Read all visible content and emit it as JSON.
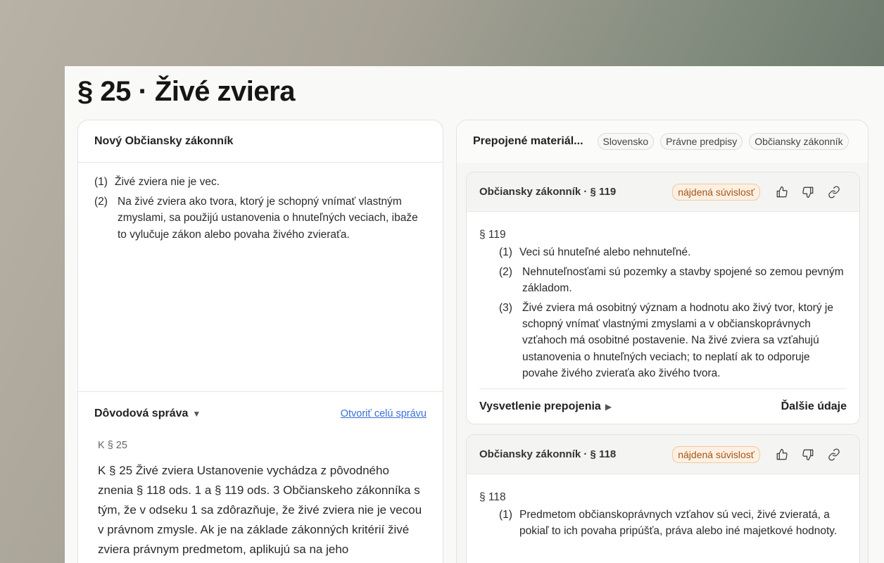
{
  "page_title": "§ 25 · Živé zviera",
  "left": {
    "header": "Nový Občiansky zákonník",
    "paragraphs": [
      {
        "num": "(1)",
        "text": "Živé zviera nie je vec."
      },
      {
        "num": "(2)",
        "text": "Na živé zviera ako tvora, ktorý je schopný vnímať vlastným zmyslami, sa použijú ustanovenia o hnuteľných veciach, ibaže to vylučuje zákon alebo povaha živého zvieraťa."
      }
    ],
    "report": {
      "title": "Dôvodová správa",
      "link": "Otvoriť celú správu",
      "ref": "K § 25",
      "text": "K § 25 Živé zviera Ustanovenie vychádza z pôvodného znenia § 118 ods. 1 a § 119 ods. 3 Občianskeho zákonníka s tým, že v odseku 1 sa zdôrazňuje, že živé zviera nie je vecou v právnom zmysle. Ak je na základe zákonných kritérií živé zviera právnym predmetom, aplikujú sa na jeho"
    }
  },
  "right": {
    "header": "Prepojené materiál...",
    "tags": [
      "Slovensko",
      "Právne predpisy",
      "Občiansky zákonník"
    ],
    "cards": [
      {
        "title": "Občiansky zákonník · § 119",
        "badge": "nájdená súvislosť",
        "section": "§ 119",
        "paragraphs": [
          {
            "num": "(1)",
            "text": "Veci sú hnuteľné alebo nehnuteľné."
          },
          {
            "num": "(2)",
            "text": "Nehnuteľnosťami sú pozemky a stavby spojené so zemou pevným základom."
          },
          {
            "num": "(3)",
            "text": "Živé zviera má osobitný význam a hodnotu ako živý tvor, ktorý je schopný vnímať vlastnými zmyslami a v občianskoprávnych vzťahoch má osobitné postavenie. Na živé zviera sa vzťahujú ustanovenia o hnuteľných veciach; to neplatí ak to odporuje povahe živého zvieraťa ako živého tvora."
          }
        ],
        "explain": "Vysvetlenie prepojenia",
        "more": "Ďalšie údaje"
      },
      {
        "title": "Občiansky zákonník · § 118",
        "badge": "nájdená súvislosť",
        "section": "§ 118",
        "paragraphs": [
          {
            "num": "(1)",
            "text": "Predmetom občianskoprávnych vzťahov sú veci, živé zvieratá, a pokiaľ to ich povaha pripúšťa, práva alebo iné majetkové hodnoty."
          }
        ]
      }
    ]
  },
  "icons": {
    "thumbs_up": "thumbs-up-icon",
    "thumbs_down": "thumbs-down-icon",
    "link": "link-icon",
    "report_toggle": "triangle-down-icon",
    "explain_toggle": "triangle-right-icon"
  },
  "colors": {
    "badge_text": "#a2551a",
    "badge_bg": "#fdf0e2",
    "link": "#3a6fd8"
  }
}
